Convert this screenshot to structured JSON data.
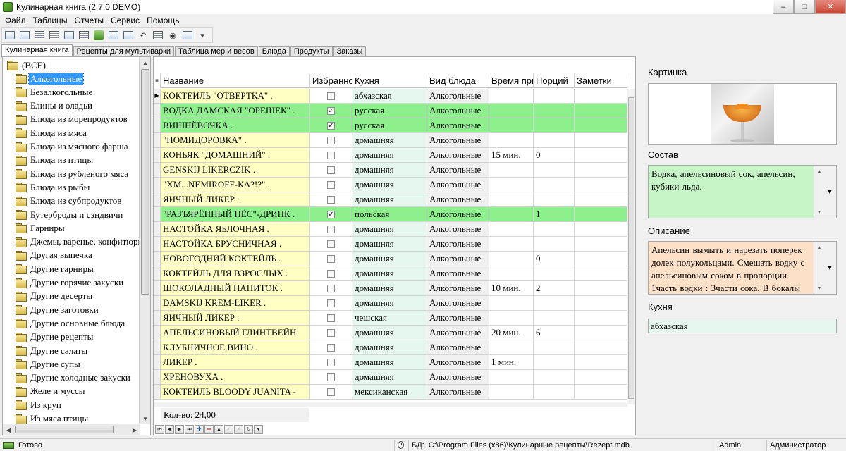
{
  "window": {
    "title": "Кулинарная книга (2.7.0 DEMO)"
  },
  "menu": [
    "Файл",
    "Таблицы",
    "Отчеты",
    "Сервис",
    "Помощь"
  ],
  "tabs": [
    "Кулинарная книга",
    "Рецепты для мультиварки",
    "Таблица мер и весов",
    "Блюда",
    "Продукты",
    "Заказы"
  ],
  "tree": {
    "root": "(ВСЕ)",
    "items": [
      "Алкогольные",
      "Безалкогольные",
      "Блины и оладьи",
      "Блюда из морепродуктов",
      "Блюда из мяса",
      "Блюда из мясного фарша",
      "Блюда из птицы",
      "Блюда из рубленого мяса",
      "Блюда из рыбы",
      "Блюда из субпродуктов",
      "Бутерброды и сэндвичи",
      "Гарниры",
      "Джемы, варенье, конфитюры",
      "Другая выпечка",
      "Другие гарниры",
      "Другие горячие закуски",
      "Другие десерты",
      "Другие заготовки",
      "Другие основные блюда",
      "Другие рецепты",
      "Другие салаты",
      "Другие супы",
      "Другие холодные закуски",
      "Желе и муссы",
      "Из круп",
      "Из мяса птицы"
    ]
  },
  "grid": {
    "columns": [
      "Название",
      "Избранное",
      "Кухня",
      "Вид блюда",
      "Время приготовления",
      "Порций",
      "Заметки"
    ],
    "rows": [
      {
        "name": "КОКТЕЙЛЬ \"ОТВЕРТКА\" .",
        "fav": false,
        "kitchen": "абхазская",
        "type": "Алкогольные",
        "time": "",
        "portions": "",
        "notes": "",
        "highlight": false,
        "current": true
      },
      {
        "name": "ВОДКА ДАМСКАЯ \"ОРЕШЕК\" .",
        "fav": true,
        "kitchen": "русская",
        "type": "Алкогольные",
        "time": "",
        "portions": "",
        "notes": "",
        "highlight": true
      },
      {
        "name": "ВИШНЁВОЧКА .",
        "fav": true,
        "kitchen": "русская",
        "type": "Алкогольные",
        "time": "",
        "portions": "",
        "notes": "",
        "highlight": true
      },
      {
        "name": "\"ПОМИДОРОВКА\" .",
        "fav": false,
        "kitchen": "домашняя",
        "type": "Алкогольные",
        "time": "",
        "portions": "",
        "notes": "",
        "highlight": false
      },
      {
        "name": "КОНЬЯК \"ДОМАШНИЙ\" .",
        "fav": false,
        "kitchen": "домашняя",
        "type": "Алкогольные",
        "time": "15 мин.",
        "portions": "0",
        "notes": "",
        "highlight": false
      },
      {
        "name": "GENSKIJ LIKERCZIK .",
        "fav": false,
        "kitchen": "домашняя",
        "type": "Алкогольные",
        "time": "",
        "portions": "",
        "notes": "",
        "highlight": false
      },
      {
        "name": "\"ХМ...NEMIROFF-КА?!?\" .",
        "fav": false,
        "kitchen": "домашняя",
        "type": "Алкогольные",
        "time": "",
        "portions": "",
        "notes": "",
        "highlight": false
      },
      {
        "name": "ЯИЧНЫЙ ЛИКЕР .",
        "fav": false,
        "kitchen": "домашняя",
        "type": "Алкогольные",
        "time": "",
        "portions": "",
        "notes": "",
        "highlight": false
      },
      {
        "name": "\"РАЗЪЯРЁННЫЙ ПЁС\"-ДРИНК .",
        "fav": true,
        "kitchen": "польская",
        "type": "Алкогольные",
        "time": "",
        "portions": "1",
        "notes": "",
        "highlight": true
      },
      {
        "name": "НАСТОЙКА ЯБЛОЧНАЯ .",
        "fav": false,
        "kitchen": "домашняя",
        "type": "Алкогольные",
        "time": "",
        "portions": "",
        "notes": "",
        "highlight": false
      },
      {
        "name": "НАСТОЙКА БРУСНИЧНАЯ .",
        "fav": false,
        "kitchen": "домашняя",
        "type": "Алкогольные",
        "time": "",
        "portions": "",
        "notes": "",
        "highlight": false
      },
      {
        "name": "НОВОГОДНИЙ КОКТЕЙЛЬ .",
        "fav": false,
        "kitchen": "домашняя",
        "type": "Алкогольные",
        "time": "",
        "portions": "0",
        "notes": "",
        "highlight": false
      },
      {
        "name": "КОКТЕЙЛЬ ДЛЯ ВЗРОСЛЫХ .",
        "fav": false,
        "kitchen": "домашняя",
        "type": "Алкогольные",
        "time": "",
        "portions": "",
        "notes": "",
        "highlight": false
      },
      {
        "name": "ШОКОЛАДНЫЙ НАПИТОК .",
        "fav": false,
        "kitchen": "домашняя",
        "type": "Алкогольные",
        "time": "10 мин.",
        "portions": "2",
        "notes": "",
        "highlight": false
      },
      {
        "name": "DAMSKIJ KREM-LIKER .",
        "fav": false,
        "kitchen": "домашняя",
        "type": "Алкогольные",
        "time": "",
        "portions": "",
        "notes": "",
        "highlight": false
      },
      {
        "name": "ЯИЧНЫЙ ЛИКЕР .",
        "fav": false,
        "kitchen": "чешская",
        "type": "Алкогольные",
        "time": "",
        "portions": "",
        "notes": "",
        "highlight": false
      },
      {
        "name": "АПЕЛЬСИНОВЫЙ ГЛИНТВЕЙН",
        "fav": false,
        "kitchen": "домашняя",
        "type": "Алкогольные",
        "time": "20 мин.",
        "portions": "6",
        "notes": "",
        "highlight": false
      },
      {
        "name": "КЛУБНИЧНОЕ ВИНО .",
        "fav": false,
        "kitchen": "домашняя",
        "type": "Алкогольные",
        "time": "",
        "portions": "",
        "notes": "",
        "highlight": false
      },
      {
        "name": "ЛИКЕР .",
        "fav": false,
        "kitchen": "домашняя",
        "type": "Алкогольные",
        "time": "1 мин.",
        "portions": "",
        "notes": "",
        "highlight": false
      },
      {
        "name": "ХРЕНОВУХА .",
        "fav": false,
        "kitchen": "домашняя",
        "type": "Алкогольные",
        "time": "",
        "portions": "",
        "notes": "",
        "highlight": false
      },
      {
        "name": "КОКТЕЙЛЬ BLOODY JUANITA -",
        "fav": false,
        "kitchen": "мексиканская",
        "type": "Алкогольные",
        "time": "",
        "portions": "",
        "notes": "",
        "highlight": false
      }
    ],
    "count_label": "Кол-во: 24,00"
  },
  "details": {
    "picture_label": "Картинка",
    "composition_label": "Состав",
    "composition": "Водка, апельсиновый сок, апельсин, кубики льда.",
    "description_label": "Описание",
    "description": "Апельсин вымыть и нарезать поперек долек полукольцами. Смешать водку с апельсиновым соком в пропорции 1часть водки : 3части сока. В бокалы",
    "kitchen_label": "Кухня",
    "kitchen": "абхазская"
  },
  "status": {
    "ready": "Готово",
    "db_label": "БД:",
    "db_path": "C:\\Program Files (x86)\\Кулинарные рецепты\\Rezept.mdb",
    "user": "Admin",
    "role": "Администратор"
  }
}
